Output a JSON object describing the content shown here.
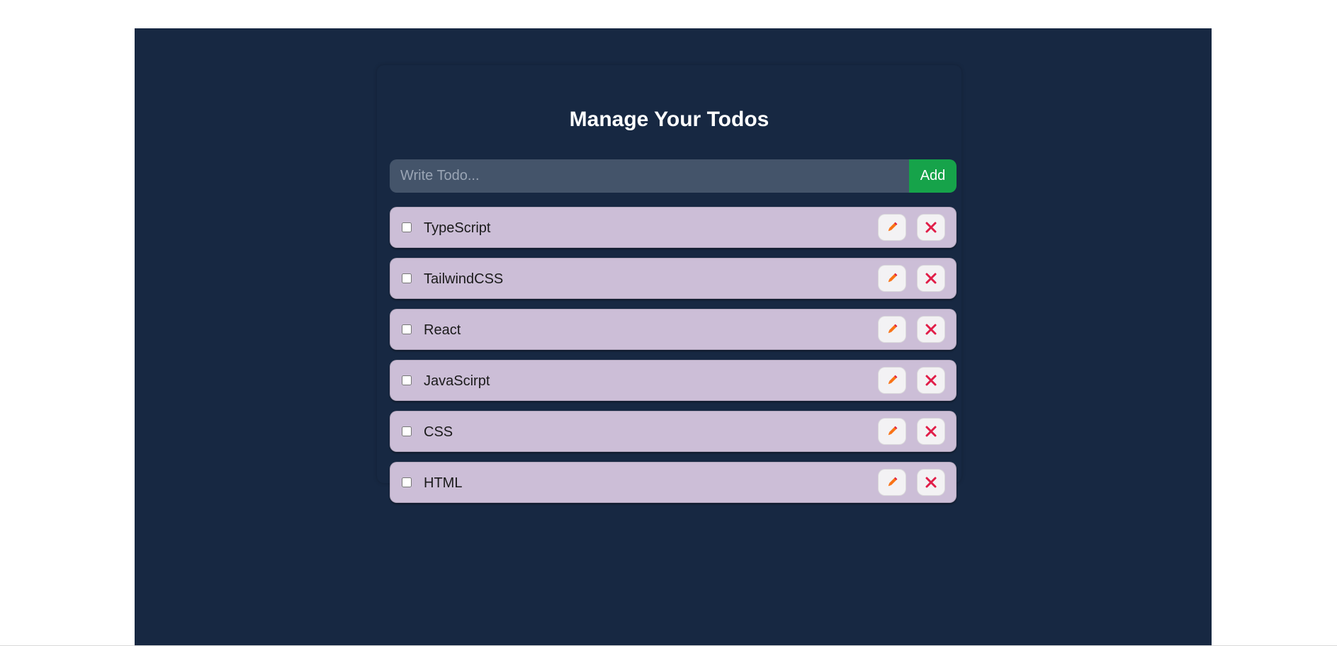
{
  "title": "Manage Your Todos",
  "form": {
    "placeholder": "Write Todo...",
    "value": "",
    "add_label": "Add"
  },
  "todos": [
    {
      "text": "TypeScript",
      "completed": false
    },
    {
      "text": "TailwindCSS",
      "completed": false
    },
    {
      "text": "React",
      "completed": false
    },
    {
      "text": "JavaScirpt",
      "completed": false
    },
    {
      "text": "CSS",
      "completed": false
    },
    {
      "text": "HTML",
      "completed": false
    }
  ],
  "icons": {
    "edit": "pencil-icon",
    "delete": "close-icon"
  },
  "colors": {
    "background": "#172842",
    "todo_item": "#ccbed7",
    "input": "#44546a",
    "add_button": "#16a34a",
    "pencil": "#f97316",
    "delete": "#e11d48"
  }
}
